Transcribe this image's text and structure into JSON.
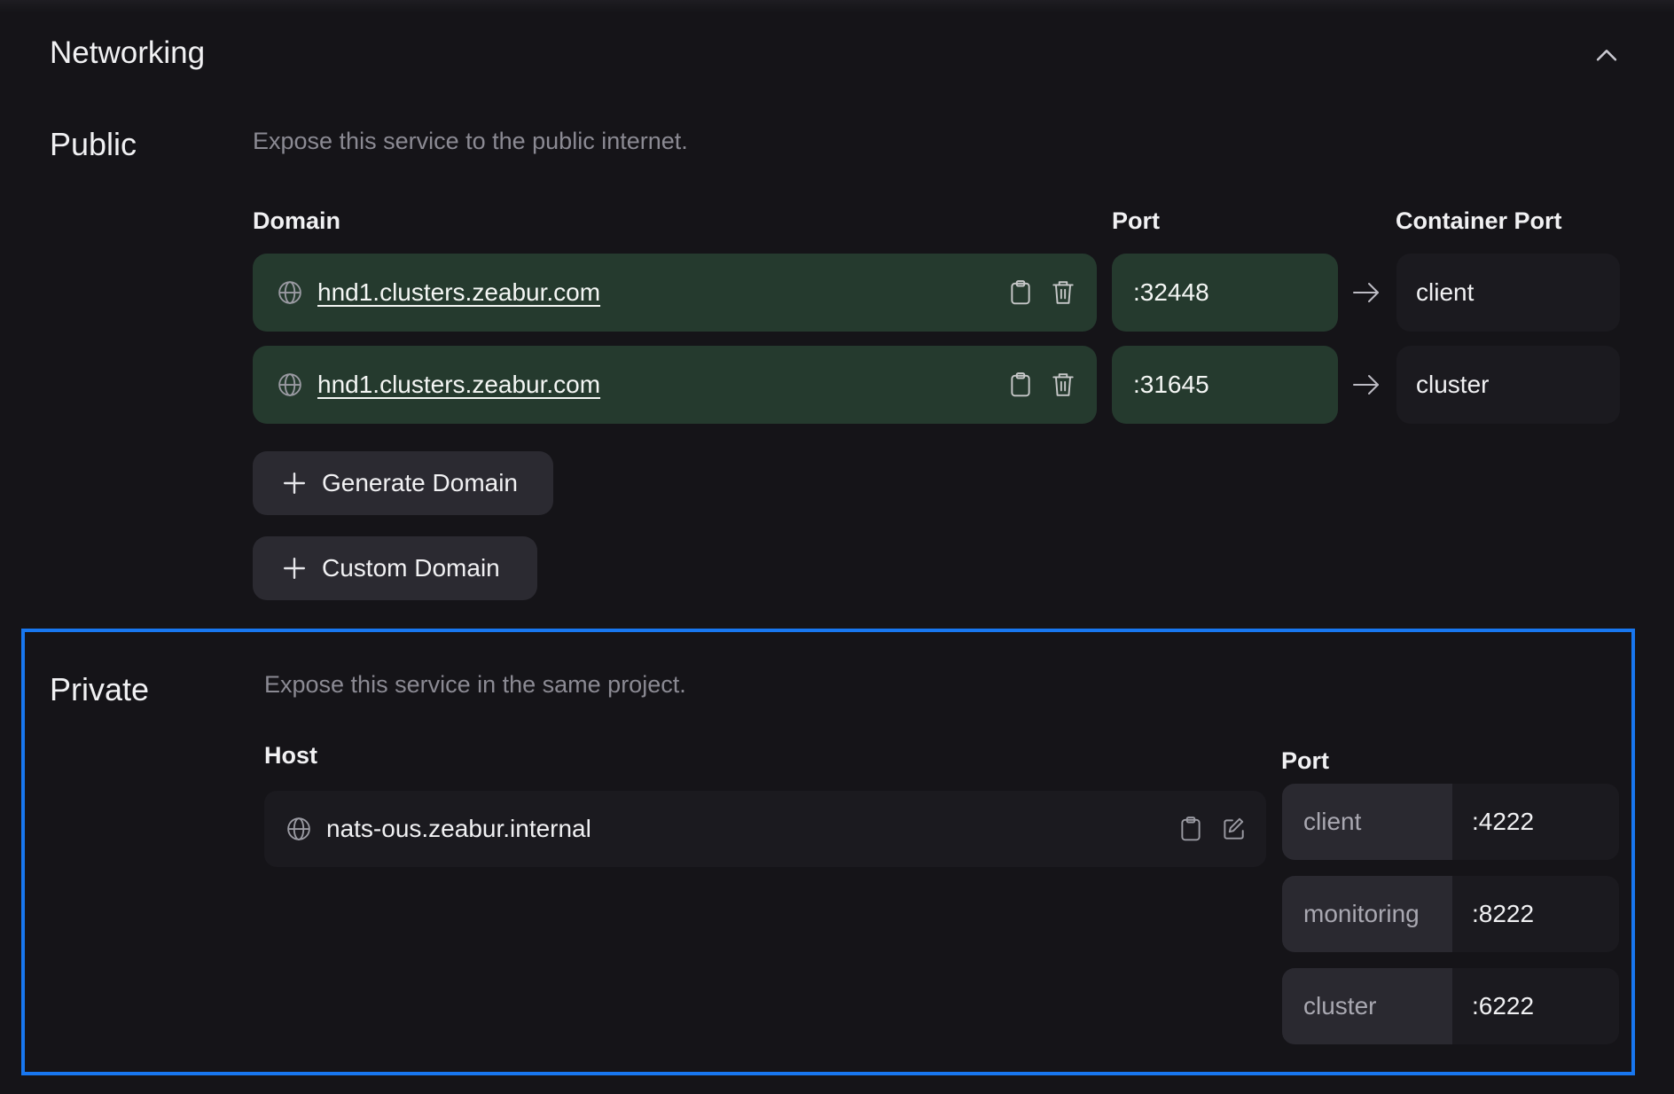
{
  "header": {
    "title": "Networking"
  },
  "public": {
    "title": "Public",
    "description": "Expose this service to the public internet.",
    "columns": {
      "domain": "Domain",
      "port": "Port",
      "container_port": "Container Port"
    },
    "rows": [
      {
        "domain": "hnd1.clusters.zeabur.com",
        "port": ":32448",
        "container_port": "client"
      },
      {
        "domain": "hnd1.clusters.zeabur.com",
        "port": ":31645",
        "container_port": "cluster"
      }
    ],
    "buttons": {
      "generate": "Generate Domain",
      "custom": "Custom Domain"
    }
  },
  "private": {
    "title": "Private",
    "description": "Expose this service in the same project.",
    "columns": {
      "host": "Host",
      "port": "Port"
    },
    "host": "nats-ous.zeabur.internal",
    "ports": [
      {
        "name": "client",
        "value": ":4222"
      },
      {
        "name": "monitoring",
        "value": ":8222"
      },
      {
        "name": "cluster",
        "value": ":6222"
      }
    ]
  },
  "colors": {
    "background": "#151418",
    "public_row": "#253a2e",
    "highlight_frame": "#1877f0"
  },
  "icons": [
    "chevron-up-icon",
    "globe-icon",
    "clipboard-icon",
    "trash-icon",
    "arrow-right-icon",
    "plus-icon",
    "edit-icon"
  ]
}
